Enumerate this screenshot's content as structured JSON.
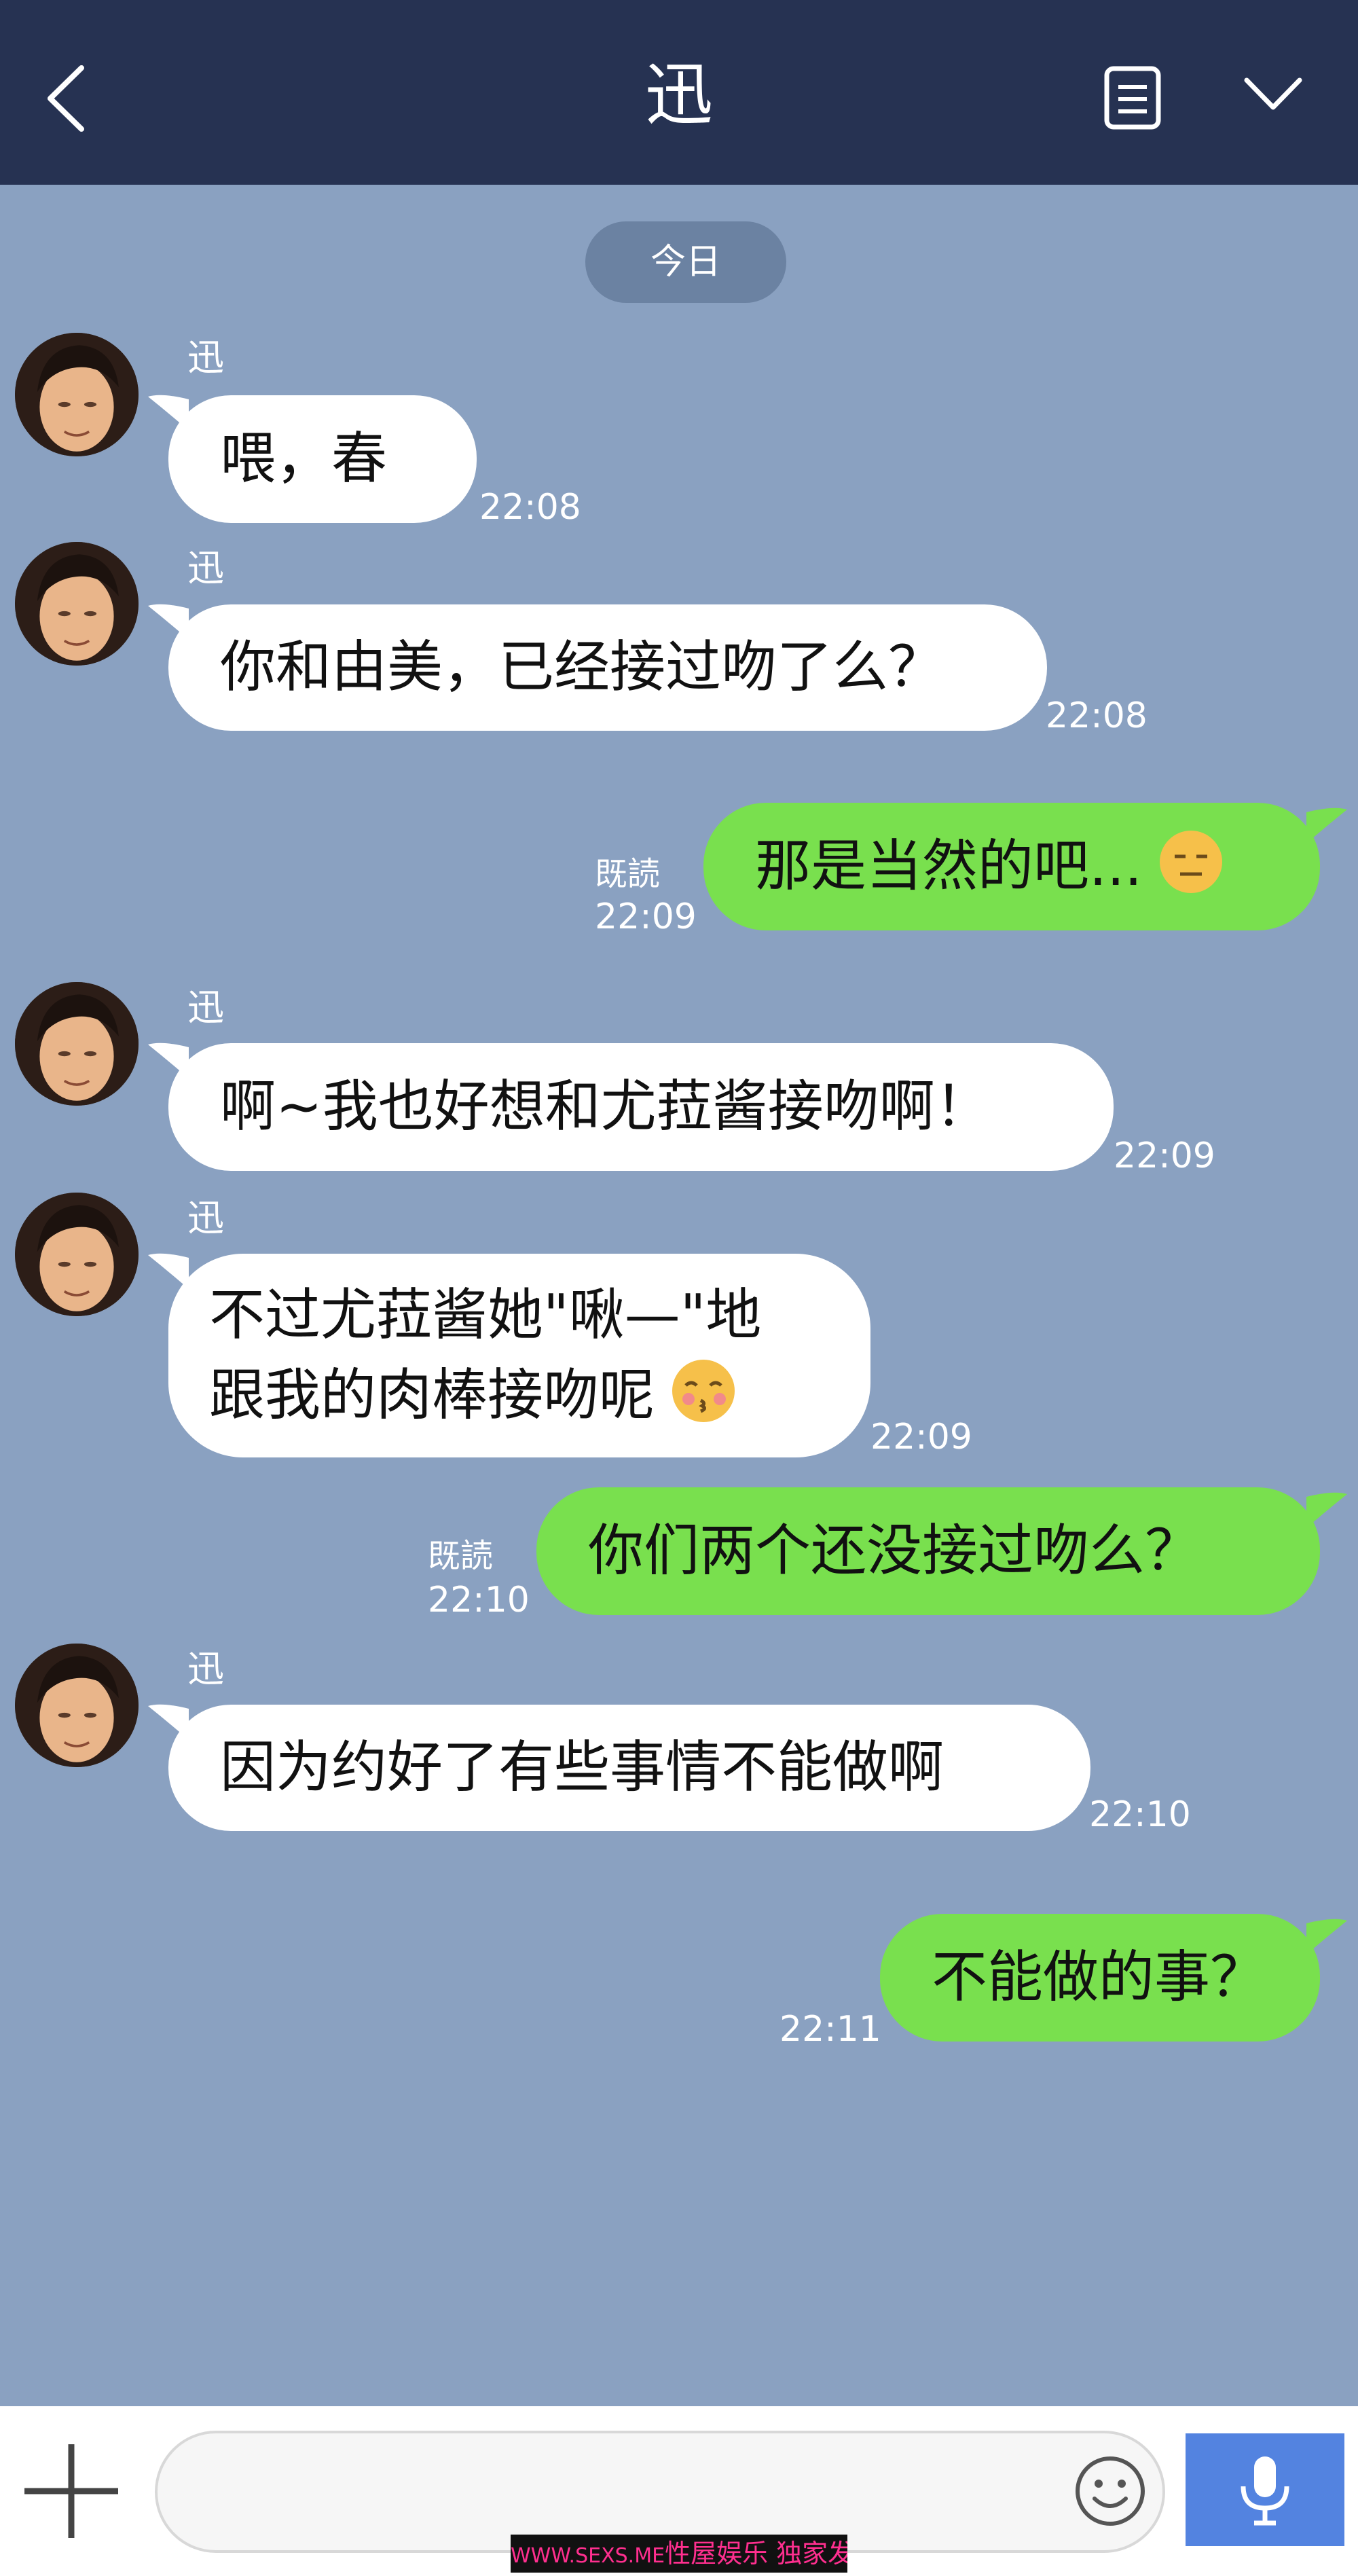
{
  "header": {
    "title": "迅"
  },
  "date_label": "今日",
  "messages": [
    {
      "side": "in",
      "sender": "迅",
      "text": "喂，春",
      "time": "22:08"
    },
    {
      "side": "in",
      "sender": "迅",
      "text": "你和由美，已经接过吻了么？",
      "time": "22:08"
    },
    {
      "side": "out",
      "read": "既読",
      "text": "那是当然的吧...",
      "emoji": "expressionless-emoji",
      "time": "22:09"
    },
    {
      "side": "in",
      "sender": "迅",
      "text": "啊~我也好想和尤菈酱接吻啊！",
      "time": "22:09"
    },
    {
      "side": "in",
      "sender": "迅",
      "line1": "不过尤菈酱她\"啾—\"地",
      "line2": "跟我的肉棒接吻呢",
      "emoji": "kissing-emoji",
      "time": "22:09"
    },
    {
      "side": "out",
      "read": "既読",
      "text": "你们两个还没接过吻么？",
      "time": "22:10"
    },
    {
      "side": "in",
      "sender": "迅",
      "text": "因为约好了有些事情不能做啊",
      "time": "22:10"
    },
    {
      "side": "out",
      "text": "不能做的事？",
      "time": "22:11"
    }
  ],
  "input": {
    "placeholder": ""
  },
  "watermark": {
    "url": "WWW.SEXS.ME",
    "text": "性屋娱乐 独家发布"
  },
  "colors": {
    "header": "#263252",
    "background": "#8aa1c1",
    "outgoing": "#79e04e",
    "incoming": "#ffffff",
    "mic": "#5383e0"
  }
}
